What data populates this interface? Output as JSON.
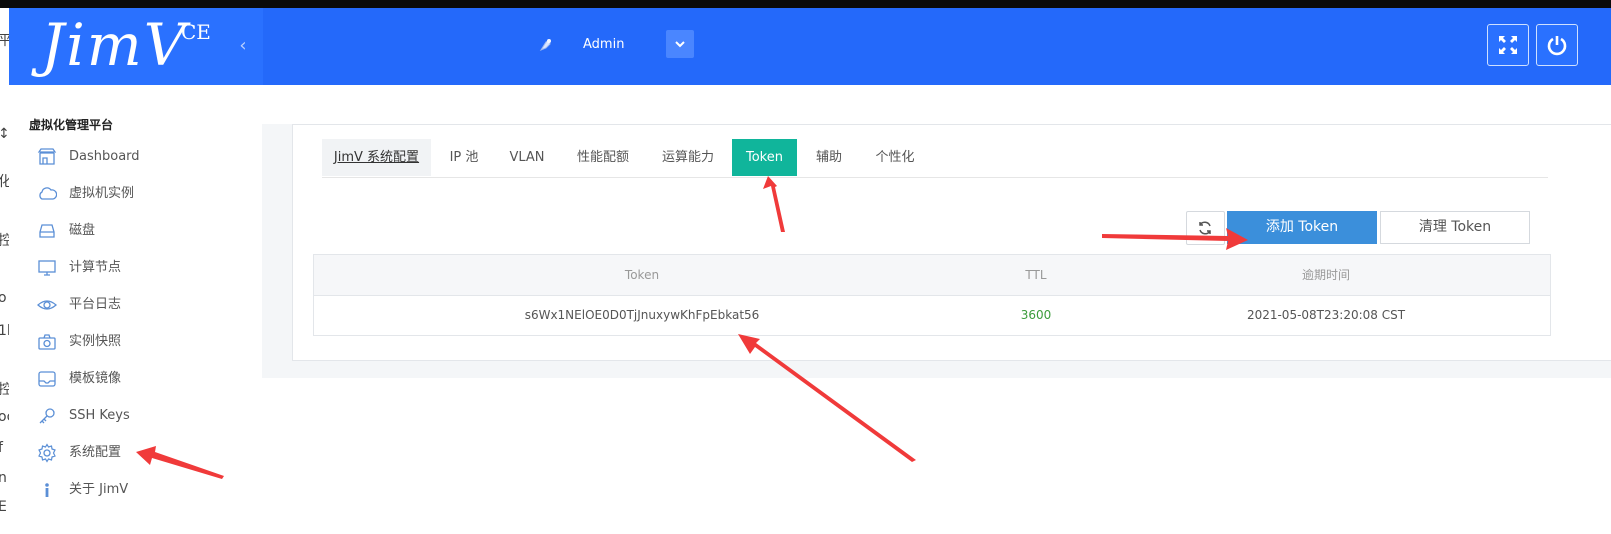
{
  "left_edge_fragments": [
    "平",
    "↕",
    "化",
    "控",
    "o",
    "1l",
    "控",
    "oc",
    "f",
    "n",
    "E"
  ],
  "header": {
    "logo_text": "JimV",
    "logo_suffix": "CE",
    "user_name": "Admin",
    "icons": [
      "collapse-icon",
      "user-avatar-icon",
      "chevron-down-icon",
      "fullscreen-icon",
      "power-icon"
    ]
  },
  "sidebar": {
    "title": "虚拟化管理平台",
    "items": [
      {
        "label": "Dashboard",
        "icon": "store-icon"
      },
      {
        "label": "虚拟机实例",
        "icon": "cloud-icon"
      },
      {
        "label": "磁盘",
        "icon": "disk-icon"
      },
      {
        "label": "计算节点",
        "icon": "monitor-icon"
      },
      {
        "label": "平台日志",
        "icon": "eye-icon"
      },
      {
        "label": "实例快照",
        "icon": "camera-icon"
      },
      {
        "label": "模板镜像",
        "icon": "image-icon"
      },
      {
        "label": "SSH Keys",
        "icon": "key-icon"
      },
      {
        "label": "系统配置",
        "icon": "gear-icon"
      },
      {
        "label": "关于 JimV",
        "icon": "info-icon"
      }
    ]
  },
  "tabs": [
    "JimV 系统配置",
    "IP 池",
    "VLAN",
    "性能配额",
    "运算能力",
    "Token",
    "辅助",
    "个性化"
  ],
  "active_tab": "Token",
  "toolbar": {
    "add_label": "添加 Token",
    "clear_label": "清理 Token"
  },
  "table": {
    "columns": [
      "Token",
      "TTL",
      "逾期时间"
    ],
    "rows": [
      {
        "token": "s6Wx1NElOE0D0TjJnuxywKhFpEbkat56",
        "ttl": "3600",
        "expire": "2021-05-08T23:20:08 CST"
      }
    ]
  },
  "colors": {
    "header_blue": "#2a71ff",
    "active_tab": "#10b59b",
    "primary_button": "#3b8fdb",
    "ttl_green": "#3c9c3c",
    "annotation_arrow": "#f03a3a"
  }
}
